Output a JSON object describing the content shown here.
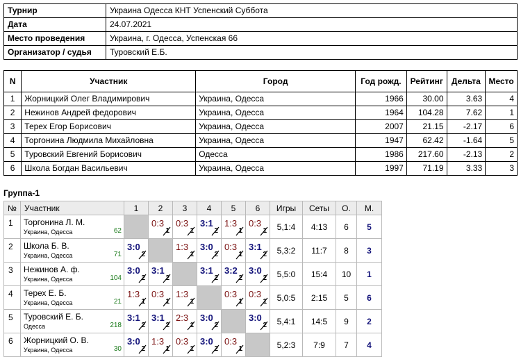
{
  "info": [
    {
      "key": "Турнир",
      "value": "Украина Одесса КНТ Успенский  Суббота"
    },
    {
      "key": "Дата",
      "value": "24.07.2021"
    },
    {
      "key": "Место проведения",
      "value": "Украина, г. Одесса, Успенская 66"
    },
    {
      "key": "Организатор / судья",
      "value": "Туровский Е.Б."
    }
  ],
  "participants": {
    "headers": [
      "N",
      "Участник",
      "Город",
      "Год рожд.",
      "Рейтинг",
      "Дельта",
      "Место"
    ],
    "rows": [
      [
        "1",
        "Жорницкий Олег Владимирович",
        "Украина, Одесса",
        "1966",
        "30.00",
        "3.63",
        "4"
      ],
      [
        "2",
        "Нежинов Андрей федорович",
        "Украина, Одесса",
        "1964",
        "104.28",
        "7.62",
        "1"
      ],
      [
        "3",
        "Терех Егор Борисович",
        "Украина, Одесса",
        "2007",
        "21.15",
        "-2.17",
        "6"
      ],
      [
        "4",
        "Торгонина Людмила Михайловна",
        "Украина, Одесса",
        "1947",
        "62.42",
        "-1.64",
        "5"
      ],
      [
        "5",
        "Туровский Евгений Борисович",
        "Одесса",
        "1986",
        "217.60",
        "-2.13",
        "2"
      ],
      [
        "6",
        "Школа Богдан Васильевич",
        "Украина, Одесса",
        "1997",
        "71.19",
        "3.33",
        "3"
      ]
    ]
  },
  "group": {
    "title": "Группа-1",
    "headers": [
      "№",
      "Участник",
      "1",
      "2",
      "3",
      "4",
      "5",
      "6",
      "Игры",
      "Сеты",
      "О.",
      "М."
    ],
    "rows": [
      {
        "num": "1",
        "name": "Торгонина Л. М.",
        "city": "Украина, Одесса",
        "rating": "62",
        "cells": [
          null,
          [
            "0:3",
            "1",
            "loss"
          ],
          [
            "0:3",
            "1",
            "loss"
          ],
          [
            "3:1",
            "2",
            "win"
          ],
          [
            "1:3",
            "1",
            "loss"
          ],
          [
            "0:3",
            "1",
            "loss"
          ]
        ],
        "games": "5,1:4",
        "sets": "4:13",
        "points": "6",
        "place": "5"
      },
      {
        "num": "2",
        "name": "Школа Б. В.",
        "city": "Украина, Одесса",
        "rating": "71",
        "cells": [
          [
            "3:0",
            "2",
            "win"
          ],
          null,
          [
            "1:3",
            "1",
            "loss"
          ],
          [
            "3:0",
            "2",
            "win"
          ],
          [
            "0:3",
            "1",
            "loss"
          ],
          [
            "3:1",
            "2",
            "win"
          ]
        ],
        "games": "5,3:2",
        "sets": "11:7",
        "points": "8",
        "place": "3"
      },
      {
        "num": "3",
        "name": "Нежинов А. ф.",
        "city": "Украина, Одесса",
        "rating": "104",
        "cells": [
          [
            "3:0",
            "2",
            "win"
          ],
          [
            "3:1",
            "2",
            "win"
          ],
          null,
          [
            "3:1",
            "2",
            "win"
          ],
          [
            "3:2",
            "2",
            "win"
          ],
          [
            "3:0",
            "2",
            "win"
          ]
        ],
        "games": "5,5:0",
        "sets": "15:4",
        "points": "10",
        "place": "1"
      },
      {
        "num": "4",
        "name": "Терех Е. Б.",
        "city": "Украина, Одесса",
        "rating": "21",
        "cells": [
          [
            "1:3",
            "1",
            "loss"
          ],
          [
            "0:3",
            "1",
            "loss"
          ],
          [
            "1:3",
            "1",
            "loss"
          ],
          null,
          [
            "0:3",
            "1",
            "loss"
          ],
          [
            "0:3",
            "1",
            "loss"
          ]
        ],
        "games": "5,0:5",
        "sets": "2:15",
        "points": "5",
        "place": "6"
      },
      {
        "num": "5",
        "name": "Туровский Е. Б.",
        "city": "Одесса",
        "rating": "218",
        "cells": [
          [
            "3:1",
            "2",
            "win"
          ],
          [
            "3:1",
            "2",
            "win"
          ],
          [
            "2:3",
            "1",
            "loss"
          ],
          [
            "3:0",
            "2",
            "win"
          ],
          null,
          [
            "3:0",
            "2",
            "win"
          ]
        ],
        "games": "5,4:1",
        "sets": "14:5",
        "points": "9",
        "place": "2"
      },
      {
        "num": "6",
        "name": "Жорницкий О. В.",
        "city": "Украина, Одесса",
        "rating": "30",
        "cells": [
          [
            "3:0",
            "2",
            "win"
          ],
          [
            "1:3",
            "1",
            "loss"
          ],
          [
            "0:3",
            "1",
            "loss"
          ],
          [
            "3:0",
            "2",
            "win"
          ],
          [
            "0:3",
            "1",
            "loss"
          ],
          null
        ],
        "games": "5,2:3",
        "sets": "7:9",
        "points": "7",
        "place": "4"
      }
    ]
  }
}
